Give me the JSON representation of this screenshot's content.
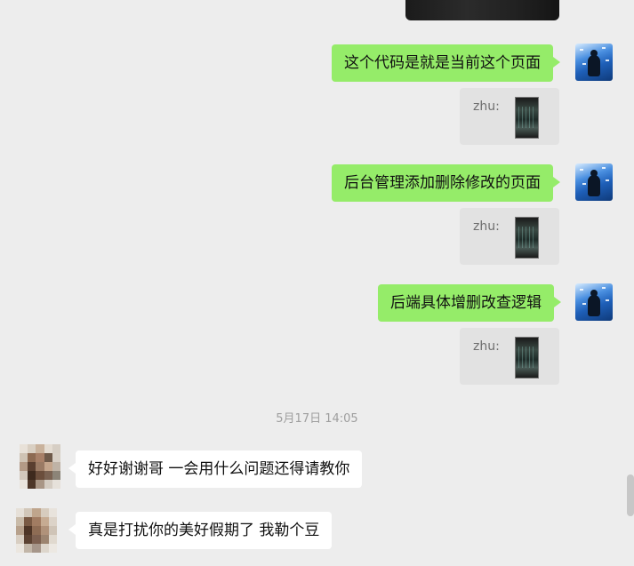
{
  "messages_out": [
    {
      "text": "这个代码是就是当前这个页面",
      "quote_label": "zhu:"
    },
    {
      "text": "后台管理添加删除修改的页面",
      "quote_label": "zhu:"
    },
    {
      "text": "后端具体增删改查逻辑",
      "quote_label": "zhu:"
    }
  ],
  "timestamp": "5月17日 14:05",
  "messages_in": [
    {
      "text": "好好谢谢哥 一会用什么问题还得请教你"
    },
    {
      "text": "真是打扰你的美好假期了 我勒个豆"
    }
  ],
  "colors": {
    "background": "#ededed",
    "outgoing_bubble": "#95ec69",
    "incoming_bubble": "#ffffff",
    "quote_box": "#e2e2e2"
  }
}
